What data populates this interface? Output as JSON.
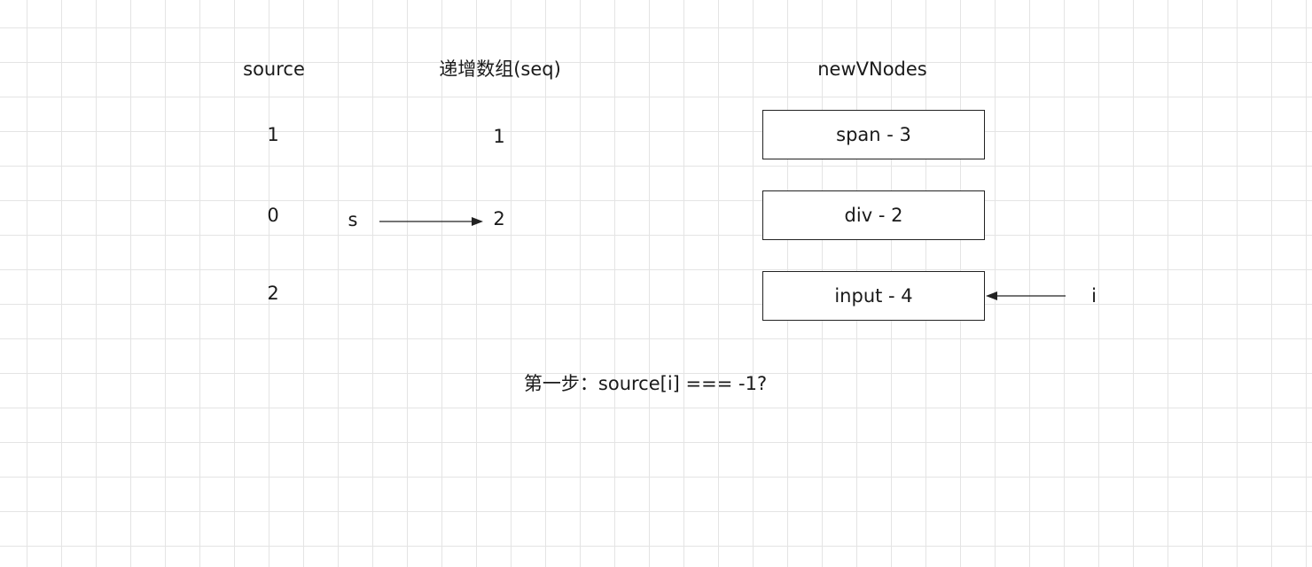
{
  "headers": {
    "source": "source",
    "seq": "递增数组(seq)",
    "new_vnodes": "newVNodes"
  },
  "source_values": [
    "1",
    "0",
    "2"
  ],
  "seq_values": [
    "1",
    "2"
  ],
  "new_vnodes": [
    "span - 3",
    "div - 2",
    "input - 4"
  ],
  "pointers": {
    "s": "s",
    "i": "i"
  },
  "step_caption": "第一步：source[i] === -1?",
  "colors": {
    "grid": "#e4e4e4",
    "line": "#222222",
    "background": "#ffffff"
  }
}
